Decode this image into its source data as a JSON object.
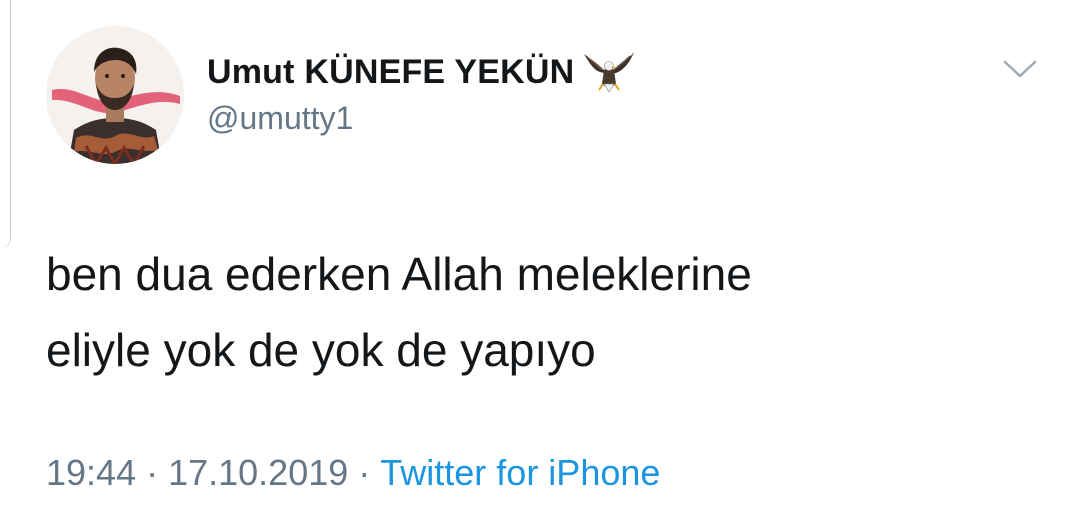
{
  "tweet": {
    "author": {
      "display_name": "Umut KÜNEFE YEKÜN",
      "handle": "@umutty1",
      "badge_icon": "eagle-icon",
      "avatar_icon": "profile-photo"
    },
    "text_lines": [
      "ben dua ederken Allah meleklerine",
      "eliyle yok de yok de yapıyo"
    ],
    "time": "19:44",
    "separator": "·",
    "date": "17.10.2019",
    "source": "Twitter for iPhone",
    "menu_icon": "chevron-down-icon"
  },
  "colors": {
    "text": "#14171a",
    "secondary": "#657786",
    "link": "#1b95e0",
    "background": "#ffffff"
  }
}
